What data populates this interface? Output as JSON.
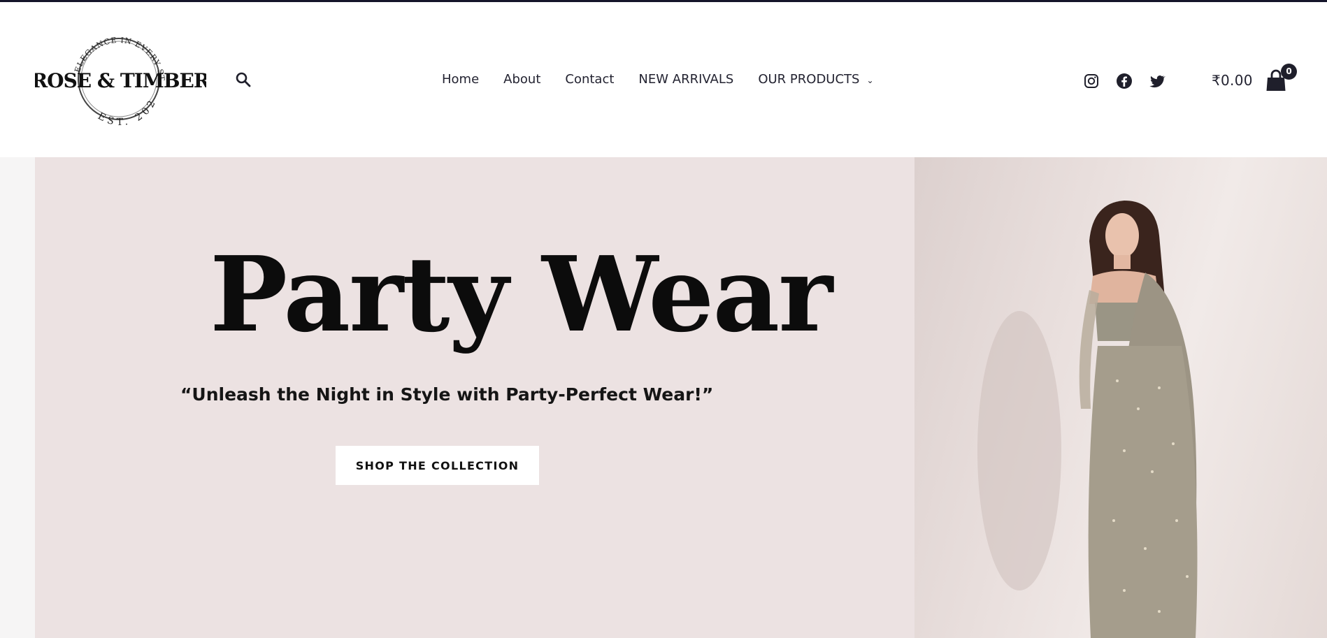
{
  "brand": {
    "name": "ROSE & TIMBER",
    "tagline": "ELEGANCE IN EVERY STITCH",
    "established": "EST. 2024"
  },
  "header": {
    "search_icon": "search-icon",
    "nav": [
      {
        "label": "Home"
      },
      {
        "label": "About"
      },
      {
        "label": "Contact"
      },
      {
        "label": "NEW ARRIVALS"
      },
      {
        "label": "OUR PRODUCTS",
        "has_dropdown": true
      }
    ],
    "social": [
      "instagram-icon",
      "facebook-icon",
      "twitter-icon"
    ],
    "cart": {
      "total": "₹0.00",
      "count": "0",
      "icon": "shopping-bag-icon"
    }
  },
  "hero": {
    "title": "Party Wear",
    "subtitle": "“Unleash the Night in Style with Party-Perfect Wear!”",
    "button_label": "SHOP THE COLLECTION"
  },
  "colors": {
    "top_bar": "#15152a",
    "hero_background": "#ece2e2",
    "text_dark": "#232331",
    "button_background": "#ffffff"
  }
}
